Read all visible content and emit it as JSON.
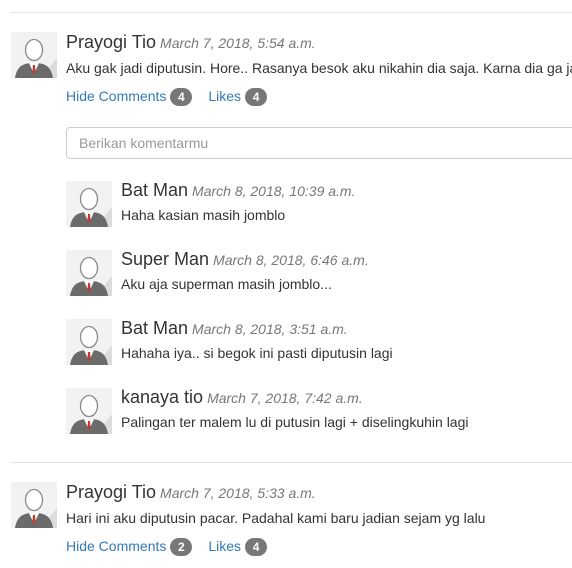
{
  "posts": [
    {
      "author": "Prayogi Tio",
      "time": "March 7, 2018, 5:54 a.m.",
      "text": "Aku gak jadi diputusin. Hore.. Rasanya besok aku nikahin dia saja. Karna dia ga ja",
      "hide_comments_label": "Hide Comments",
      "comment_count": "4",
      "likes_label": "Likes",
      "likes_count": "4",
      "comment_placeholder": "Berikan komentarmu",
      "comments": [
        {
          "author": "Bat Man",
          "time": "March 8, 2018, 10:39 a.m.",
          "text": "Haha kasian masih jomblo"
        },
        {
          "author": "Super Man",
          "time": "March 8, 2018, 6:46 a.m.",
          "text": "Aku aja superman masih jomblo..."
        },
        {
          "author": "Bat Man",
          "time": "March 8, 2018, 3:51 a.m.",
          "text": "Hahaha iya.. si begok ini pasti diputusin lagi"
        },
        {
          "author": "kanaya tio",
          "time": "March 7, 2018, 7:42 a.m.",
          "text": "Palingan ter malem lu di putusin lagi + diselingkuhin lagi"
        }
      ]
    },
    {
      "author": "Prayogi Tio",
      "time": "March 7, 2018, 5:33 a.m.",
      "text": "Hari ini aku diputusin pacar. Padahal kami baru jadian sejam yg lalu",
      "hide_comments_label": "Hide Comments",
      "comment_count": "2",
      "likes_label": "Likes",
      "likes_count": "4"
    }
  ],
  "colors": {
    "link": "#337ab7",
    "badge": "#777777",
    "time": "#777777",
    "tie": "#c0392b"
  },
  "icons": {
    "avatar": "default-user-avatar-icon"
  }
}
